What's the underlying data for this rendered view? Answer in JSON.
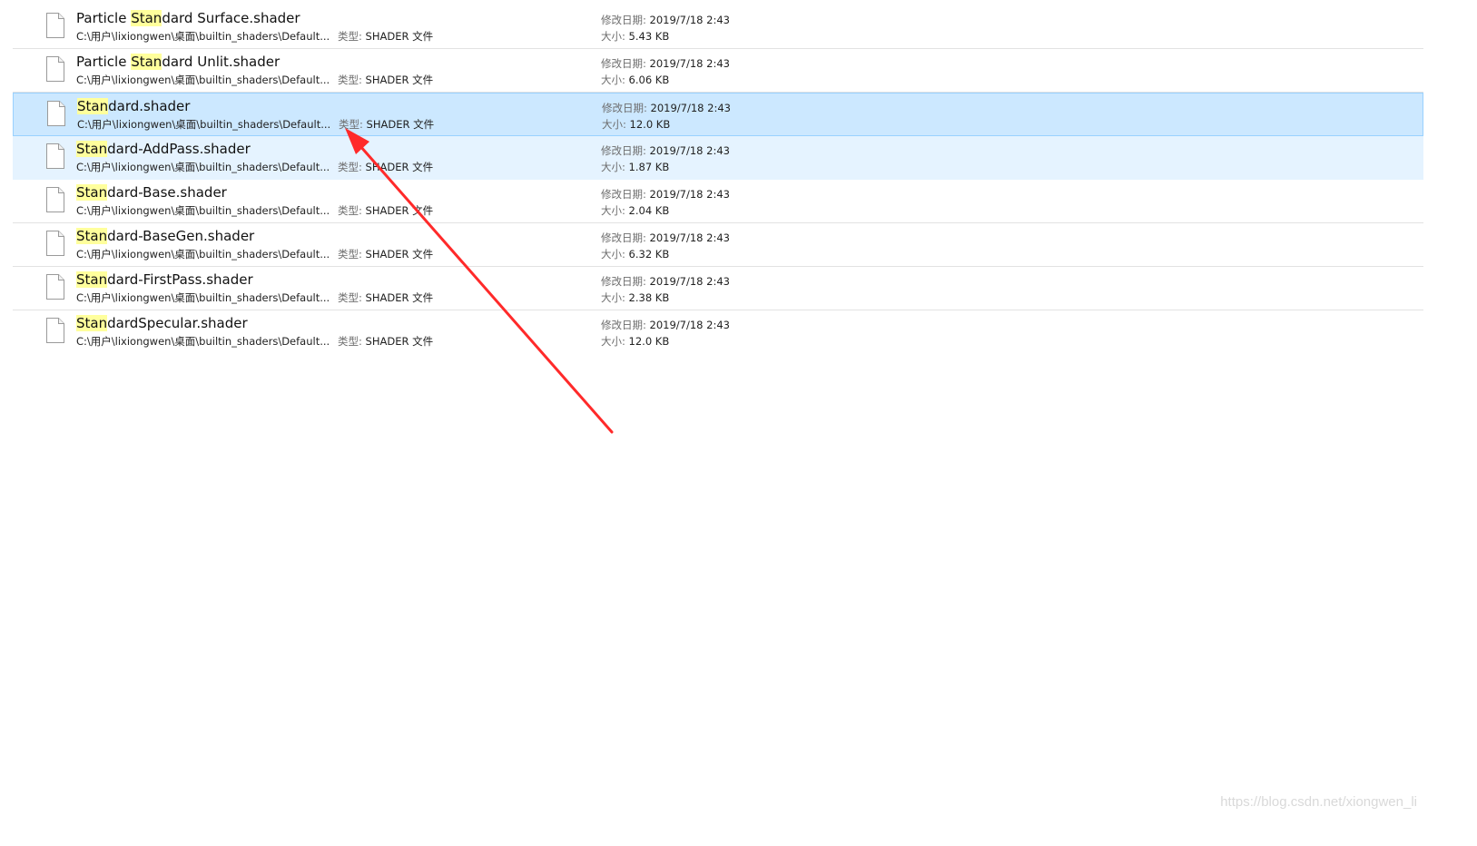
{
  "labels": {
    "type": "类型: ",
    "modified": "修改日期: ",
    "size": "大小: "
  },
  "results": [
    {
      "name_pre": "Particle ",
      "name_hl": "Stan",
      "name_post": "dard Surface.shader",
      "path": "C:\\用户\\lixiongwen\\桌面\\builtin_shaders\\Default...",
      "type": "SHADER 文件",
      "modified": "2019/7/18 2:43",
      "size": "5.43 KB"
    },
    {
      "name_pre": "Particle ",
      "name_hl": "Stan",
      "name_post": "dard Unlit.shader",
      "path": "C:\\用户\\lixiongwen\\桌面\\builtin_shaders\\Default...",
      "type": "SHADER 文件",
      "modified": "2019/7/18 2:43",
      "size": "6.06 KB"
    },
    {
      "name_pre": "",
      "name_hl": "Stan",
      "name_post": "dard.shader",
      "path": "C:\\用户\\lixiongwen\\桌面\\builtin_shaders\\Default...",
      "type": "SHADER 文件",
      "modified": "2019/7/18 2:43",
      "size": "12.0 KB"
    },
    {
      "name_pre": "",
      "name_hl": "Stan",
      "name_post": "dard-AddPass.shader",
      "path": "C:\\用户\\lixiongwen\\桌面\\builtin_shaders\\Default...",
      "type": "SHADER 文件",
      "modified": "2019/7/18 2:43",
      "size": "1.87 KB"
    },
    {
      "name_pre": "",
      "name_hl": "Stan",
      "name_post": "dard-Base.shader",
      "path": "C:\\用户\\lixiongwen\\桌面\\builtin_shaders\\Default...",
      "type": "SHADER 文件",
      "modified": "2019/7/18 2:43",
      "size": "2.04 KB"
    },
    {
      "name_pre": "",
      "name_hl": "Stan",
      "name_post": "dard-BaseGen.shader",
      "path": "C:\\用户\\lixiongwen\\桌面\\builtin_shaders\\Default...",
      "type": "SHADER 文件",
      "modified": "2019/7/18 2:43",
      "size": "6.32 KB"
    },
    {
      "name_pre": "",
      "name_hl": "Stan",
      "name_post": "dard-FirstPass.shader",
      "path": "C:\\用户\\lixiongwen\\桌面\\builtin_shaders\\Default...",
      "type": "SHADER 文件",
      "modified": "2019/7/18 2:43",
      "size": "2.38 KB"
    },
    {
      "name_pre": "",
      "name_hl": "Stan",
      "name_post": "dardSpecular.shader",
      "path": "C:\\用户\\lixiongwen\\桌面\\builtin_shaders\\Default...",
      "type": "SHADER 文件",
      "modified": "2019/7/18 2:43",
      "size": "12.0 KB"
    }
  ],
  "selected_index": 2,
  "hover_index": 3,
  "colors": {
    "selected_bg": "#cce8ff",
    "selected_border": "#99d1ff",
    "hover_bg": "#e5f3ff",
    "match_highlight": "#ffff9c",
    "arrow": "#ff2a2a"
  },
  "icons": {
    "file": "file-icon",
    "annotation": "arrow-annotation"
  },
  "watermark": "https://blog.csdn.net/xiongwen_li"
}
